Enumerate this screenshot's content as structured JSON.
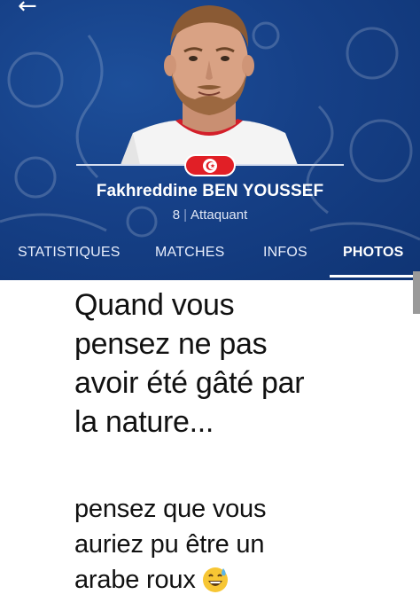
{
  "app": {
    "back_glyph": "←",
    "accent_color": "#164087",
    "flag_color": "#e11f26"
  },
  "player": {
    "name": "Fakhreddine BEN YOUSSEF",
    "number": "8",
    "position": "Attaquant",
    "flag_icon": "tunisia-flag-icon"
  },
  "tabs": [
    {
      "label": "STATISTIQUES",
      "active": false
    },
    {
      "label": "MATCHES",
      "active": false
    },
    {
      "label": "INFOS",
      "active": false
    },
    {
      "label": "PHOTOS",
      "active": true
    }
  ],
  "meme": {
    "line1": "Quand vous",
    "line2": "pensez ne pas",
    "line3": "avoir été gâté par",
    "line4": "la nature...",
    "line5": "pensez que vous",
    "line6": "auriez pu être un",
    "line7": "arabe roux",
    "emoji_icon": "grinning-sweat-emoji-icon"
  }
}
